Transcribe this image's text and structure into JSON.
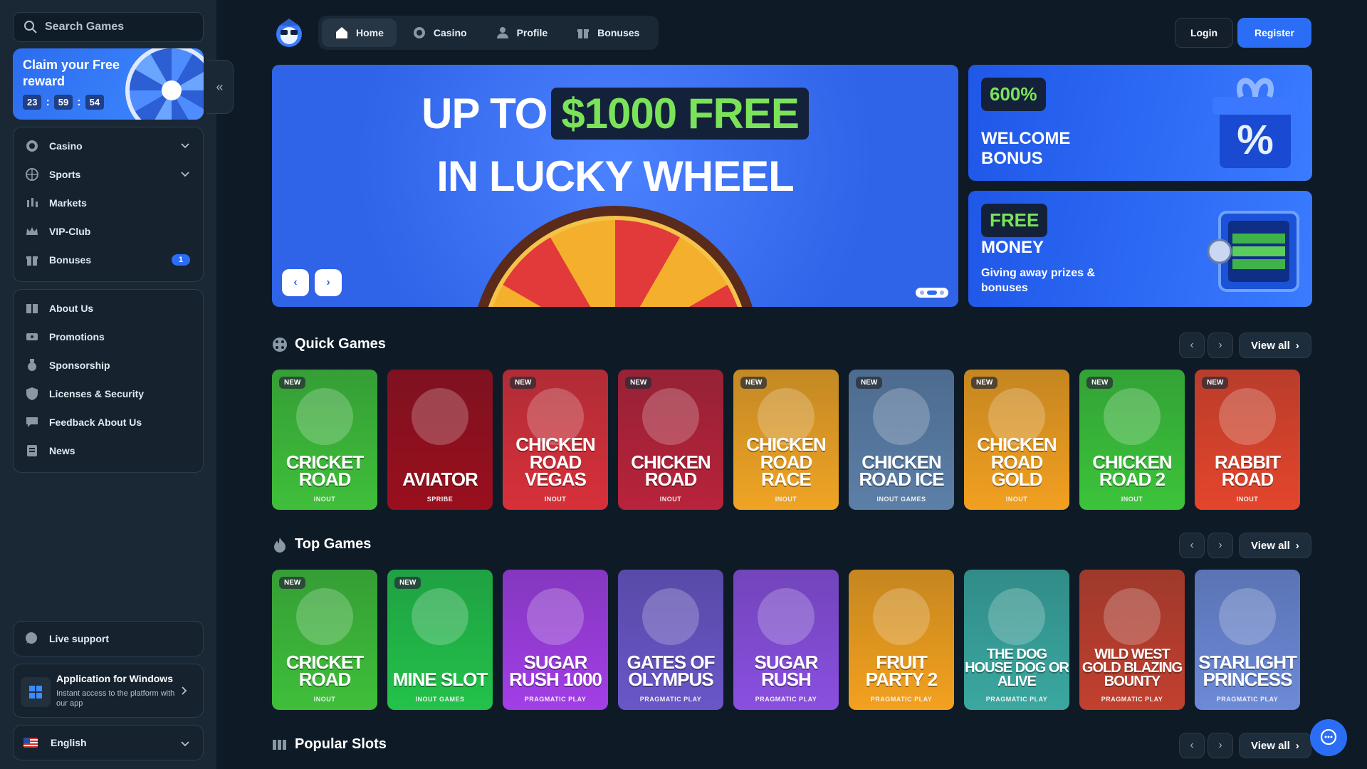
{
  "sidebar": {
    "search_placeholder": "Search Games",
    "reward": {
      "title": "Claim your Free reward",
      "hours": "23",
      "minutes": "59",
      "seconds": "54"
    },
    "menu1": [
      {
        "label": "Casino",
        "icon": "casino-chip-icon",
        "dropdown": true
      },
      {
        "label": "Sports",
        "icon": "globe-icon",
        "dropdown": true
      },
      {
        "label": "Markets",
        "icon": "candlestick-icon"
      },
      {
        "label": "VIP-Club",
        "icon": "crown-icon"
      },
      {
        "label": "Bonuses",
        "icon": "gift-icon",
        "badge": "1"
      }
    ],
    "menu2": [
      {
        "label": "About Us",
        "icon": "book-icon"
      },
      {
        "label": "Promotions",
        "icon": "ticket-icon"
      },
      {
        "label": "Sponsorship",
        "icon": "medal-icon"
      },
      {
        "label": "Licenses & Security",
        "icon": "shield-icon"
      },
      {
        "label": "Feedback About Us",
        "icon": "feedback-icon"
      },
      {
        "label": "News",
        "icon": "newspaper-icon"
      }
    ],
    "support": "Live support",
    "app": {
      "title": "Application for Windows",
      "desc": "Instant access to the platform with our app"
    },
    "language": "English"
  },
  "nav": {
    "tabs": [
      {
        "label": "Home",
        "icon": "home-icon",
        "active": true
      },
      {
        "label": "Casino",
        "icon": "casino-chip-icon"
      },
      {
        "label": "Profile",
        "icon": "user-icon"
      },
      {
        "label": "Bonuses",
        "icon": "gift-icon"
      }
    ],
    "login": "Login",
    "register": "Register"
  },
  "hero": {
    "line1a": "UP TO",
    "line1b": "$1000 FREE",
    "line2": "IN LUCKY WHEEL"
  },
  "promos": [
    {
      "tag": "600%",
      "title": "WELCOME BONUS",
      "sub": ""
    },
    {
      "tag": "FREE",
      "title": "MONEY",
      "sub": "Giving away prizes & bonuses"
    }
  ],
  "sections": {
    "quick": {
      "title": "Quick Games",
      "view_all": "View all"
    },
    "top": {
      "title": "Top Games",
      "view_all": "View all"
    },
    "popular": {
      "title": "Popular Slots",
      "view_all": "View all"
    }
  },
  "quick_games": [
    {
      "name": "CRICKET ROAD",
      "provider": "INOUT",
      "new": "NEW",
      "color": "#3fbf3a"
    },
    {
      "name": "AVIATOR",
      "provider": "SPRIBE",
      "new": "",
      "color": "#9a0f1e"
    },
    {
      "name": "CHICKEN ROAD VEGAS",
      "provider": "INOUT",
      "new": "NEW",
      "color": "#d8303a"
    },
    {
      "name": "CHICKEN ROAD",
      "provider": "INOUT",
      "new": "NEW",
      "color": "#b8233a"
    },
    {
      "name": "CHICKEN ROAD RACE",
      "provider": "INOUT",
      "new": "NEW",
      "color": "#f0a424"
    },
    {
      "name": "CHICKEN ROAD ICE",
      "provider": "INOUT GAMES",
      "new": "NEW",
      "color": "#5c7fa8"
    },
    {
      "name": "CHICKEN ROAD GOLD",
      "provider": "INOUT",
      "new": "NEW",
      "color": "#f2a020"
    },
    {
      "name": "CHICKEN ROAD 2",
      "provider": "INOUT",
      "new": "NEW",
      "color": "#3cc43a"
    },
    {
      "name": "RABBIT ROAD",
      "provider": "INOUT",
      "new": "NEW",
      "color": "#e4452c"
    }
  ],
  "top_games": [
    {
      "name": "CRICKET ROAD",
      "provider": "INOUT",
      "new": "NEW",
      "color": "#3fbf3a"
    },
    {
      "name": "MINE SLOT",
      "provider": "INOUT GAMES",
      "new": "NEW",
      "color": "#23c24a"
    },
    {
      "name": "SUGAR RUSH 1000",
      "provider": "PRAGMATIC PLAY",
      "new": "",
      "color": "#a23ee6"
    },
    {
      "name": "GATES OF OLYMPUS",
      "provider": "PRAGMATIC PLAY",
      "new": "",
      "color": "#6a56c8"
    },
    {
      "name": "SUGAR RUSH",
      "provider": "PRAGMATIC PLAY",
      "new": "",
      "color": "#8a4fe0"
    },
    {
      "name": "FRUIT PARTY 2",
      "provider": "PRAGMATIC PLAY",
      "new": "",
      "color": "#f3a11e"
    },
    {
      "name": "THE DOG HOUSE DOG OR ALIVE",
      "provider": "PRAGMATIC PLAY",
      "new": "",
      "color": "#3aa8a0"
    },
    {
      "name": "WILD WEST GOLD BLAZING BOUNTY",
      "provider": "PRAGMATIC PLAY",
      "new": "",
      "color": "#c2402e"
    },
    {
      "name": "STARLIGHT PRINCESS",
      "provider": "PRAGMATIC PLAY",
      "new": "",
      "color": "#6d8ad8"
    }
  ]
}
